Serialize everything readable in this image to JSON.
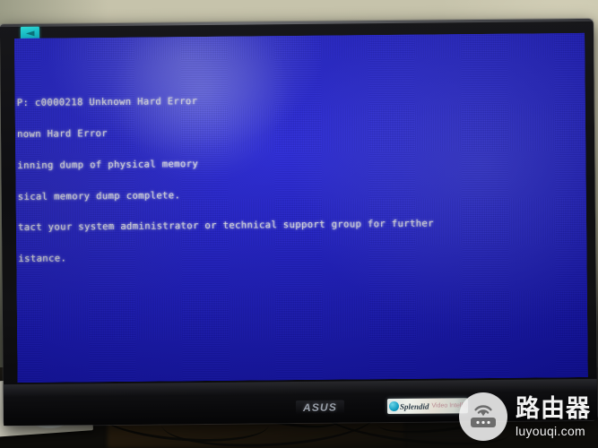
{
  "photo": {
    "subject": "ASUS monitor displaying a Windows blue screen of death",
    "background_color": "#c2bfa7",
    "desk_color": "#171511"
  },
  "monitor": {
    "brand_logo": "ASUS",
    "bezel_color": "#0e0e11",
    "stickers": {
      "top_left_label": "",
      "splendid": {
        "name": "Splendid",
        "sub": "Video Intelligence",
        "icon": "splendid-dot-icon",
        "arrow": "arrow-right-icon"
      }
    },
    "power_led": "power-led"
  },
  "bsod": {
    "background_color": "#1c1bd8",
    "text_color": "#e9e9f5",
    "lines": [
      "P: c0000218 Unknown Hard Error",
      "nown Hard Error",
      "inning dump of physical memory",
      "sical memory dump complete.",
      "tact your system administrator or technical support group for further",
      "istance."
    ],
    "error_code": "c0000218",
    "error_name": "Unknown Hard Error"
  },
  "watermark": {
    "cn": "路由器",
    "en": "luyouqi.com",
    "icon": "router-icon",
    "badge_color": "#f4f4f4"
  }
}
